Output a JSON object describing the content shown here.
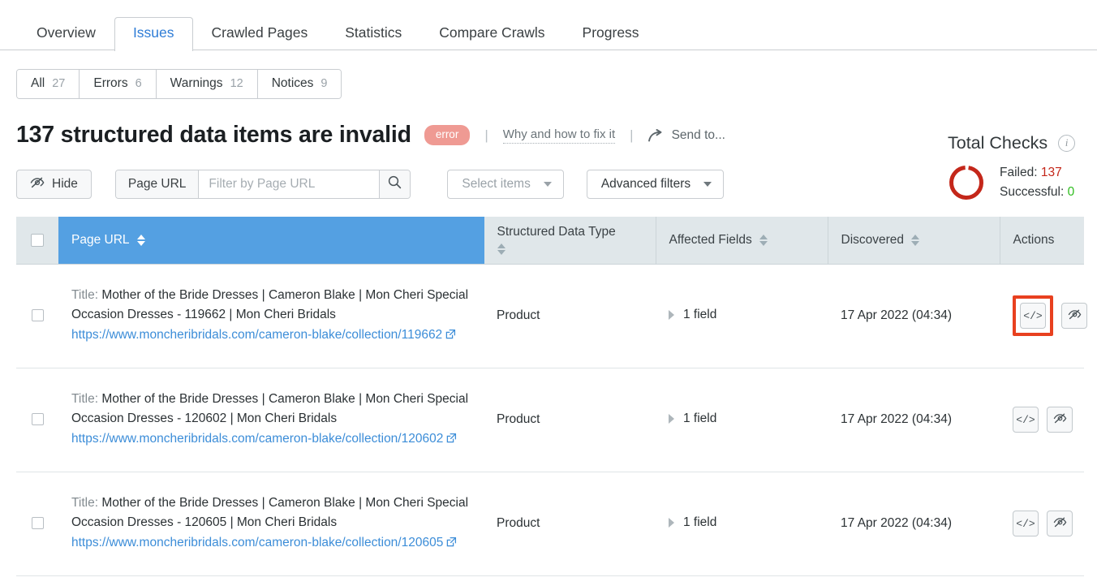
{
  "tabs": [
    {
      "label": "Overview",
      "active": false
    },
    {
      "label": "Issues",
      "active": true
    },
    {
      "label": "Crawled Pages",
      "active": false
    },
    {
      "label": "Statistics",
      "active": false
    },
    {
      "label": "Compare Crawls",
      "active": false
    },
    {
      "label": "Progress",
      "active": false
    }
  ],
  "segments": [
    {
      "label": "All",
      "count": "27"
    },
    {
      "label": "Errors",
      "count": "6"
    },
    {
      "label": "Warnings",
      "count": "12"
    },
    {
      "label": "Notices",
      "count": "9"
    }
  ],
  "issue": {
    "title": "137 structured data items are invalid",
    "badge": "error",
    "separator": "|",
    "fix_link": "Why and how to fix it",
    "send_to": "Send to...",
    "send_to_icon": "share-arrow-icon",
    "badge_color": "#ef9a93"
  },
  "total_checks": {
    "title": "Total Checks",
    "info_icon": "info-icon",
    "failed_label": "Failed:",
    "failed_value": "137",
    "successful_label": "Successful:",
    "successful_value": "0",
    "failed_color": "#c4271a",
    "successful_color": "#2fbd1f",
    "donut_color": "#c4271a",
    "donut_failed_pct": 100
  },
  "toolbar": {
    "hide_label": "Hide",
    "hide_icon": "eye-slash-icon",
    "search_scope_label": "Page URL",
    "search_placeholder": "Filter by Page URL",
    "search_value": "",
    "search_icon": "search-icon",
    "select_items_label": "Select items",
    "advanced_filters_label": "Advanced filters",
    "caret_icon": "chevron-down-icon"
  },
  "table": {
    "columns": [
      {
        "label": "Page URL",
        "sortable": true,
        "active": true
      },
      {
        "label": "Structured Data Type",
        "sortable": true,
        "active": false
      },
      {
        "label": "Affected Fields",
        "sortable": true,
        "active": false
      },
      {
        "label": "Discovered",
        "sortable": true,
        "active": false
      },
      {
        "label": "Actions",
        "sortable": false,
        "active": false
      }
    ],
    "title_prefix": "Title:",
    "external_link_icon": "external-link-icon",
    "expand_icon": "chevron-right-icon",
    "row_actions": [
      {
        "name": "view-source-button",
        "icon": "code-icon",
        "glyph": "</>"
      },
      {
        "name": "ignore-button",
        "icon": "eye-slash-icon",
        "glyph": ""
      }
    ],
    "highlight_color": "#e8401f",
    "rows": [
      {
        "title": "Mother of the Bride Dresses | Cameron Blake | Mon Cheri Special Occasion Dresses - 119662 | Mon Cheri Bridals",
        "url": "https://www.moncheribridals.com/cameron-blake/collection/119662",
        "data_type": "Product",
        "affected_fields": "1 field",
        "discovered": "17 Apr 2022 (04:34)",
        "highlighted_action": true
      },
      {
        "title": "Mother of the Bride Dresses | Cameron Blake | Mon Cheri Special Occasion Dresses - 120602 | Mon Cheri Bridals",
        "url": "https://www.moncheribridals.com/cameron-blake/collection/120602",
        "data_type": "Product",
        "affected_fields": "1 field",
        "discovered": "17 Apr 2022 (04:34)",
        "highlighted_action": false
      },
      {
        "title": "Mother of the Bride Dresses | Cameron Blake | Mon Cheri Special Occasion Dresses - 120605 | Mon Cheri Bridals",
        "url": "https://www.moncheribridals.com/cameron-blake/collection/120605",
        "data_type": "Product",
        "affected_fields": "1 field",
        "discovered": "17 Apr 2022 (04:34)",
        "highlighted_action": false
      }
    ]
  }
}
